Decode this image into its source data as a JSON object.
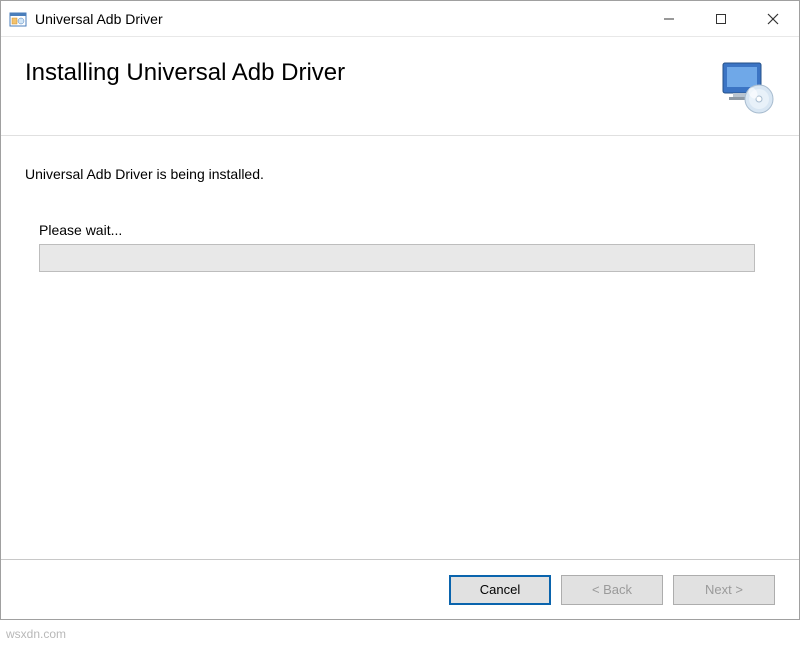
{
  "titlebar": {
    "title": "Universal Adb Driver"
  },
  "header": {
    "title": "Installing Universal Adb Driver"
  },
  "body": {
    "status_text": "Universal Adb Driver is being installed.",
    "wait_label": "Please wait..."
  },
  "footer": {
    "cancel_label": "Cancel",
    "back_label": "< Back",
    "next_label": "Next >"
  },
  "watermark": "wsxdn.com"
}
